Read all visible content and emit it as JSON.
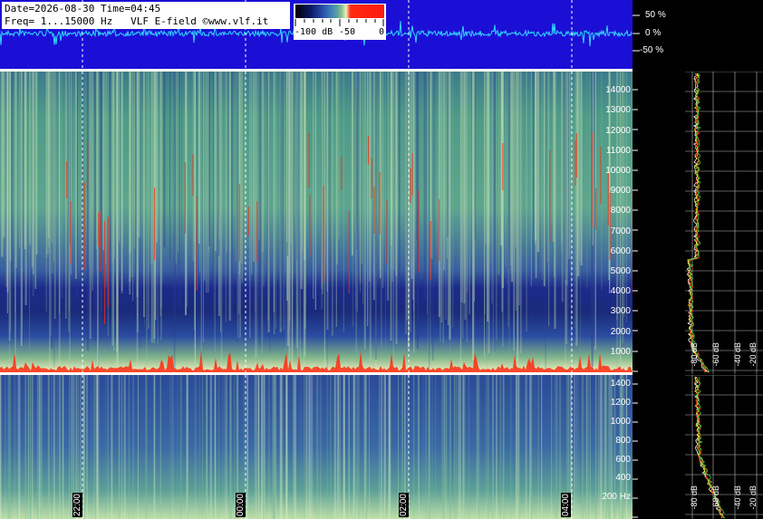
{
  "header": {
    "line1": "Date=2026-08-30 Time=04:45",
    "line2": "Freq= 1...15000 Hz   VLF E-field ©www.vlf.it"
  },
  "colorbar": {
    "labels": [
      "-100 dB",
      "-50",
      "0"
    ]
  },
  "waveform_scale": {
    "labels": [
      "50 %",
      "0 %",
      "-50 %"
    ]
  },
  "upper_freq_axis": {
    "labels": [
      "14000",
      "13000",
      "12000",
      "11000",
      "10000",
      "9000",
      "8000",
      "7000",
      "6000",
      "5000",
      "4000",
      "3000",
      "2000",
      "1000"
    ]
  },
  "lower_freq_axis": {
    "labels": [
      "1400",
      "1200",
      "1000",
      "800",
      "600",
      "400",
      "200 Hz"
    ]
  },
  "time_axis": {
    "labels": [
      "22:00",
      "00:00",
      "02:00",
      "04:00"
    ]
  },
  "upper_db_scale": {
    "labels": [
      "-80 dB",
      "-60 dB",
      "-40 dB",
      "-20 dB"
    ]
  },
  "lower_db_scale": {
    "labels": [
      "-80 dB",
      "-60 dB",
      "-40 dB",
      "-20 dB"
    ]
  },
  "colors": {
    "waveform_background": "#1b0fd6",
    "waveform_trace": "#33d6ff",
    "spectrum_low": "#1c2a8a",
    "spectrum_mid": "#5ea58f",
    "spectrum_high": "#f2f0c0",
    "spectrum_peak": "#ff2a10"
  }
}
